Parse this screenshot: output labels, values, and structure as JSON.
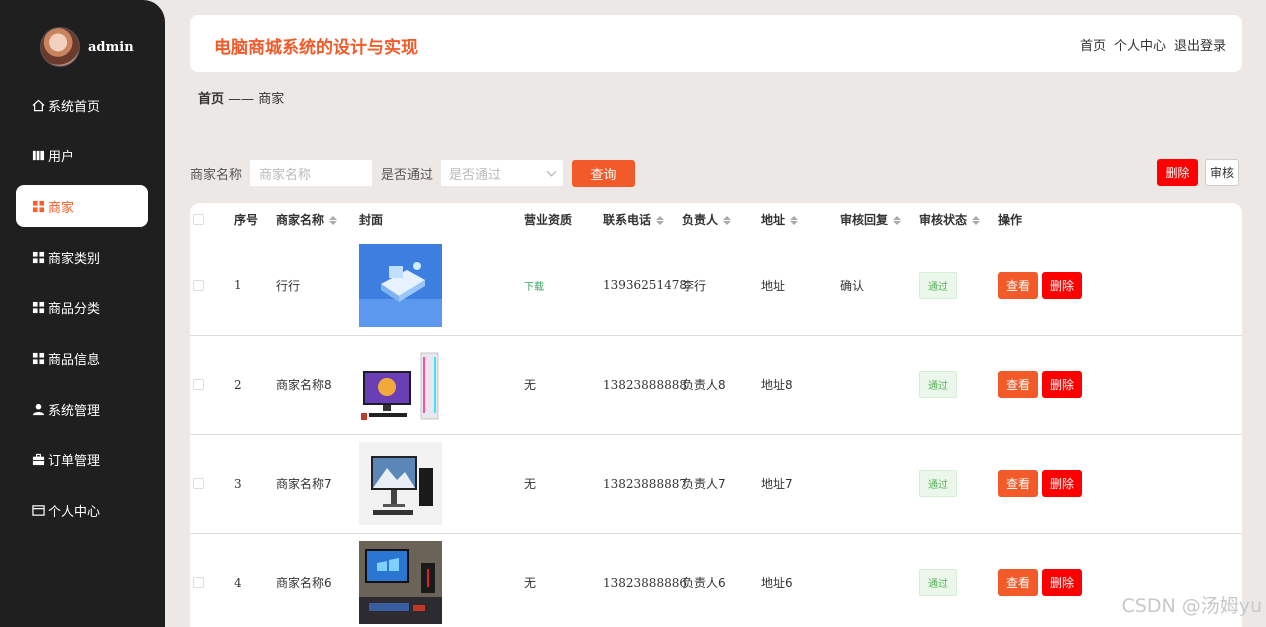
{
  "user": {
    "name": "admin"
  },
  "sidebar": {
    "items": [
      {
        "label": "系统首页",
        "icon": "home-icon"
      },
      {
        "label": "用户",
        "icon": "book-icon"
      },
      {
        "label": "商家",
        "icon": "grid-icon"
      },
      {
        "label": "商家类别",
        "icon": "grid-icon"
      },
      {
        "label": "商品分类",
        "icon": "grid-icon"
      },
      {
        "label": "商品信息",
        "icon": "grid-icon"
      },
      {
        "label": "系统管理",
        "icon": "user-icon"
      },
      {
        "label": "订单管理",
        "icon": "briefcase-icon"
      },
      {
        "label": "个人中心",
        "icon": "card-icon"
      }
    ],
    "active_index": 2
  },
  "header": {
    "title": "电脑商城系统的设计与实现",
    "nav": {
      "home": "首页",
      "profile": "个人中心",
      "logout": "退出登录"
    }
  },
  "breadcrumb": {
    "home": "首页",
    "separator": " —— ",
    "current": "商家"
  },
  "search": {
    "name_label": "商家名称",
    "name_placeholder": "商家名称",
    "pass_label": "是否通过",
    "pass_placeholder": "是否通过",
    "query_label": "查询"
  },
  "actions": {
    "delete_label": "删除",
    "audit_label": "审核"
  },
  "table": {
    "columns": [
      "序号",
      "商家名称",
      "封面",
      "营业资质",
      "联系电话",
      "负责人",
      "地址",
      "审核回复",
      "审核状态",
      "操作"
    ],
    "rows": [
      {
        "index": "1",
        "name": "行行",
        "license": "下载",
        "phone": "13936251478",
        "manager": "李行",
        "address": "地址",
        "reply": "确认",
        "status": "通过",
        "view": "查看",
        "delete": "删除"
      },
      {
        "index": "2",
        "name": "商家名称8",
        "license": "无",
        "phone": "13823888888",
        "manager": "负责人8",
        "address": "地址8",
        "reply": "",
        "status": "通过",
        "view": "查看",
        "delete": "删除"
      },
      {
        "index": "3",
        "name": "商家名称7",
        "license": "无",
        "phone": "13823888887",
        "manager": "负责人7",
        "address": "地址7",
        "reply": "",
        "status": "通过",
        "view": "查看",
        "delete": "删除"
      },
      {
        "index": "4",
        "name": "商家名称6",
        "license": "无",
        "phone": "13823888886",
        "manager": "负责人6",
        "address": "地址6",
        "reply": "",
        "status": "通过",
        "view": "查看",
        "delete": "删除"
      }
    ]
  },
  "watermark": "CSDN @汤姆yu",
  "colors": {
    "accent": "#f25a29",
    "danger": "#ff0000",
    "sidebar": "#1f1f1f",
    "success": "#59b259"
  }
}
